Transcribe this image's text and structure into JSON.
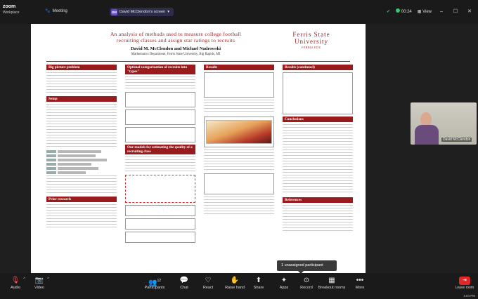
{
  "app": {
    "brand_line1": "zoom",
    "brand_line2": "Workplace",
    "meeting_label": "Meeting",
    "share_badge": "DM",
    "share_label": "David McClendon's screen",
    "timer": "00:24",
    "view_label": "View"
  },
  "poster": {
    "title_line1": "An analysis of methods used to measure college football",
    "title_line2": "recruiting classes and assign star ratings to recruits",
    "authors": "David M. McClendon and Michael Nadrowski",
    "dept": "Mathematics Department, Ferris State University, Big Rapids, MI",
    "logo_line1": "Ferris State",
    "logo_line2": "University",
    "logo_line3": "FERRIS.EDU",
    "sections": {
      "big_picture": "Big picture problem",
      "setup": "Setup",
      "prior_research": "Prior research",
      "optimal_categorization": "Optimal categorization of recruits into \"types\"",
      "our_models": "Our models for estimating the quality of a recruiting class",
      "results": "Results",
      "results_continued": "Results (continued)",
      "conclusions": "Conclusions",
      "references": "References"
    }
  },
  "participant": {
    "name": "David McClendon"
  },
  "toast": {
    "text": "1 unassigned participant"
  },
  "toolbar": {
    "audio": "Audio",
    "video": "Video",
    "participants": "Participants",
    "participants_count": "12",
    "chat": "Chat",
    "react": "React",
    "raise_hand": "Raise hand",
    "share": "Share",
    "apps": "Apps",
    "record": "Record",
    "breakout": "Breakout rooms",
    "more": "More",
    "leave": "Leave room",
    "time": "1:04 PM"
  }
}
